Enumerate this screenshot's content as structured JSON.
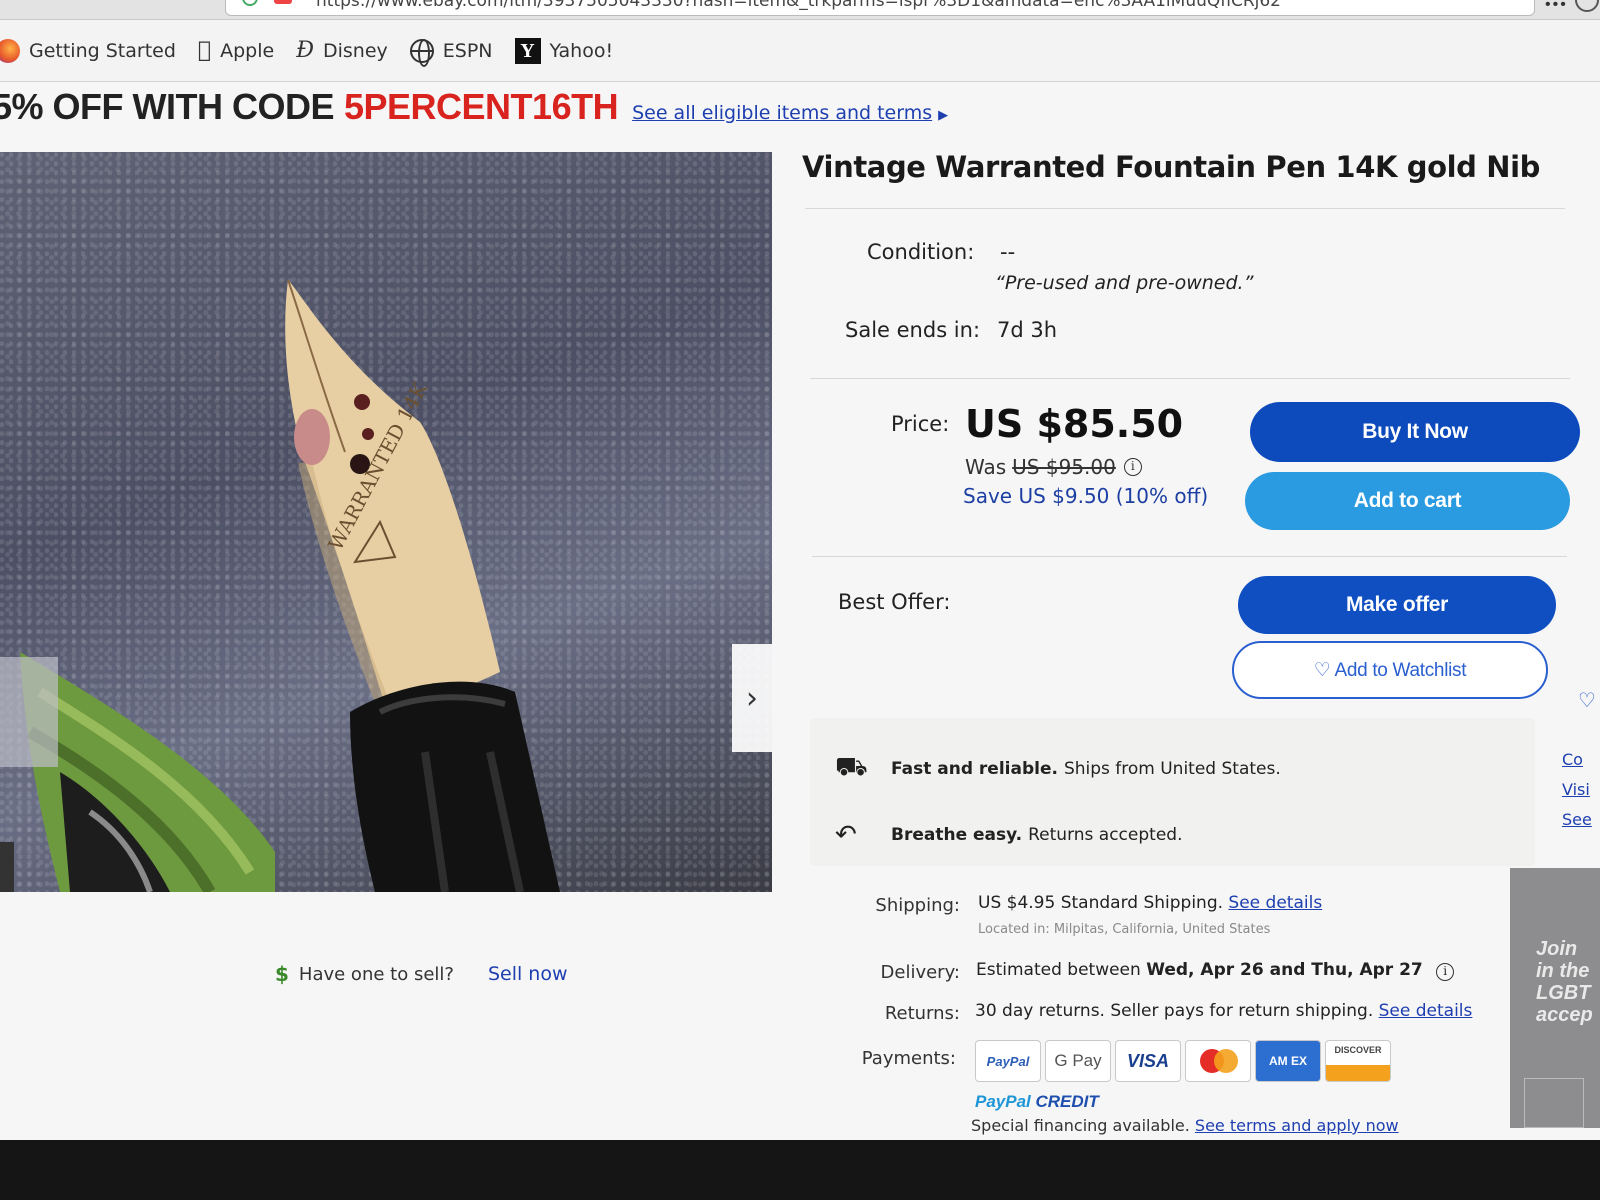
{
  "browser": {
    "url": "https://www.ebay.com/itm/3937505043330?hash=item&_trkparms=ispr%3D1&amdata=enc%3AA1iMuuQfiCRj62",
    "menu_glyph": "•••"
  },
  "bookmarks": [
    {
      "label": "Getting Started",
      "icon": "firefox-icon"
    },
    {
      "label": "Apple",
      "icon": "apple-icon"
    },
    {
      "label": "Disney",
      "icon": "disney-icon"
    },
    {
      "label": "ESPN",
      "icon": "globe-icon"
    },
    {
      "label": "Yahoo!",
      "icon": "yahoo-icon"
    }
  ],
  "promo": {
    "text": "5% OFF WITH CODE",
    "code": "5PERCENT16TH",
    "link": "See all eligible items and terms",
    "arrow": "▶"
  },
  "photo": {
    "next_glyph": "›",
    "nib_engraving": "WARRANTED 14K"
  },
  "sell": {
    "icon": "$",
    "question": "Have one to sell?",
    "button": "Sell now"
  },
  "listing": {
    "title": "Vintage Warranted Fountain Pen 14K gold Nib",
    "condition_label": "Condition:",
    "condition_value": "--",
    "condition_quote": "“Pre-used and pre-owned.”",
    "sale_label": "Sale ends in:",
    "sale_value": "7d 3h",
    "price_label": "Price:",
    "price": "US $85.50",
    "was_label": "Was",
    "was_price": "US $95.00",
    "info_glyph": "i",
    "save_text": "Save US $9.50 (10% off)",
    "best_offer_label": "Best Offer:"
  },
  "buttons": {
    "buy_now": "Buy It Now",
    "add_to_cart": "Add to cart",
    "make_offer": "Make offer",
    "add_to_watchlist": "♡ Add to Watchlist"
  },
  "perks": [
    {
      "icon": "truck-icon",
      "glyph": "⛟",
      "bold": "Fast and reliable.",
      "text": "Ships from United States."
    },
    {
      "icon": "return-arrow-icon",
      "glyph": "↶",
      "bold": "Breathe easy.",
      "text": "Returns accepted."
    }
  ],
  "details": {
    "shipping_label": "Shipping:",
    "shipping_value": "US $4.95 Standard Shipping.",
    "shipping_link": "See details",
    "located": "Located in: Milpitas, California, United States",
    "delivery_label": "Delivery:",
    "delivery_prefix": "Estimated between",
    "delivery_dates": "Wed, Apr 26 and Thu, Apr 27",
    "returns_label": "Returns:",
    "returns_value": "30 day returns. Seller pays for return shipping.",
    "returns_link": "See details",
    "payments_label": "Payments:",
    "payment_methods": [
      "PayPal",
      "G Pay",
      "VISA",
      "Mastercard",
      "AM EX",
      "DISCOVER"
    ],
    "paypal_credit_a": "PayPal",
    "paypal_credit_b": "CREDIT",
    "financing_text": "Special financing available.",
    "financing_link": "See terms and apply now"
  },
  "sidebar": {
    "links": [
      "Co",
      "Visi",
      "See"
    ],
    "ad_text": "Join\nin the\nLGBT\naccep",
    "heart": "♡"
  },
  "colors": {
    "promo_code": "#d9231f",
    "link": "#1e3fb0",
    "buy_now": "#0d4bbd",
    "add_to_cart": "#2a9be0",
    "make_offer": "#0f4fc2"
  }
}
